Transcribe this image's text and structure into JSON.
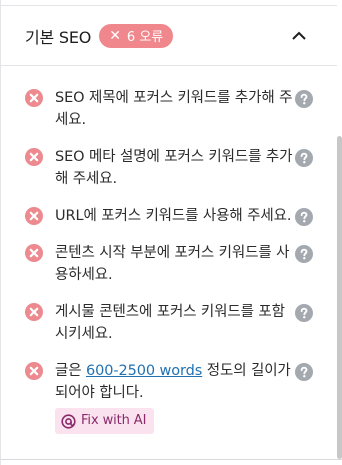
{
  "panel": {
    "title": "기본 SEO",
    "badge": {
      "icon": "close-icon",
      "label": "6 오류",
      "color": "#f0878c"
    },
    "collapse_icon": "chevron-up-icon"
  },
  "checks": [
    {
      "status": "error",
      "text": "SEO 제목에 포커스 키워드를 추가해 주세요."
    },
    {
      "status": "error",
      "text": "SEO 메타 설명에 포커스 키워드를 추가해 주세요."
    },
    {
      "status": "error",
      "text": "URL에 포커스 키워드를 사용해 주세요."
    },
    {
      "status": "error",
      "text": "콘텐츠 시작 부분에 포커스 키워드를 사용하세요."
    },
    {
      "status": "error",
      "text": "게시물 콘텐츠에 포커스 키워드를 포함시키세요."
    }
  ],
  "length_check": {
    "status": "error",
    "prefix": "글은 ",
    "link": "600-2500 words",
    "suffix": " 정도의 길이가 되어야 합니다.",
    "fix_button": "Fix with AI"
  },
  "colors": {
    "error": "#ec8a8f",
    "help": "#a4a9b0",
    "link": "#2271b1"
  }
}
